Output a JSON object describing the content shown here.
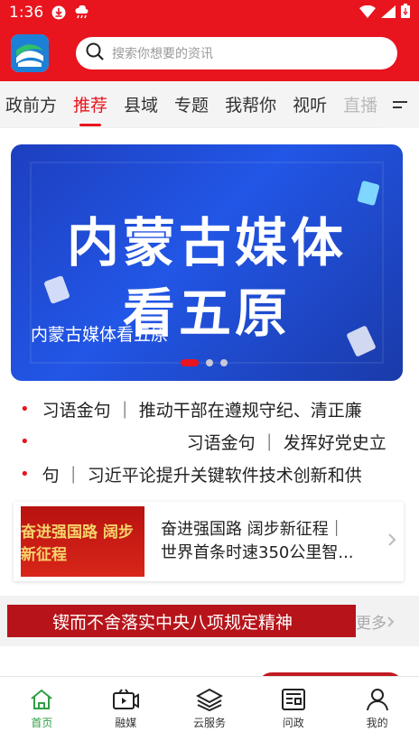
{
  "status": {
    "time": "1:36"
  },
  "search": {
    "placeholder": "搜索你想要的资讯"
  },
  "tabs": [
    {
      "label": "政前方"
    },
    {
      "label": "推荐",
      "active": true
    },
    {
      "label": "县域"
    },
    {
      "label": "专题"
    },
    {
      "label": "我帮你"
    },
    {
      "label": "视听"
    },
    {
      "label": "直播"
    }
  ],
  "banner": {
    "line1": "内蒙古媒体",
    "line2": "看五原",
    "caption": "内蒙古媒体看五原"
  },
  "ticker": [
    "习语金句 ｜ 推动干部在遵规守纪、清正廉",
    "习语金句 ｜ 发挥好党史立",
    "句 ｜ 习近平论提升关键软件技术创新和供"
  ],
  "feature": {
    "thumb_text": "奋进强国路 阔步新征程",
    "line1": "奋进强国路  阔步新征程｜",
    "line2": "世界首条时速350公里智..."
  },
  "slogan": {
    "text": "锲而不舍落实中央八项规定精神",
    "more": "更多"
  },
  "nav": [
    {
      "label": "首页",
      "icon": "home-icon",
      "active": true
    },
    {
      "label": "融媒",
      "icon": "video-icon"
    },
    {
      "label": "云服务",
      "icon": "layers-icon"
    },
    {
      "label": "问政",
      "icon": "newspaper-icon"
    },
    {
      "label": "我的",
      "icon": "user-icon"
    }
  ],
  "colors": {
    "brand_red": "#e8141e",
    "nav_active": "#2f9e44"
  }
}
